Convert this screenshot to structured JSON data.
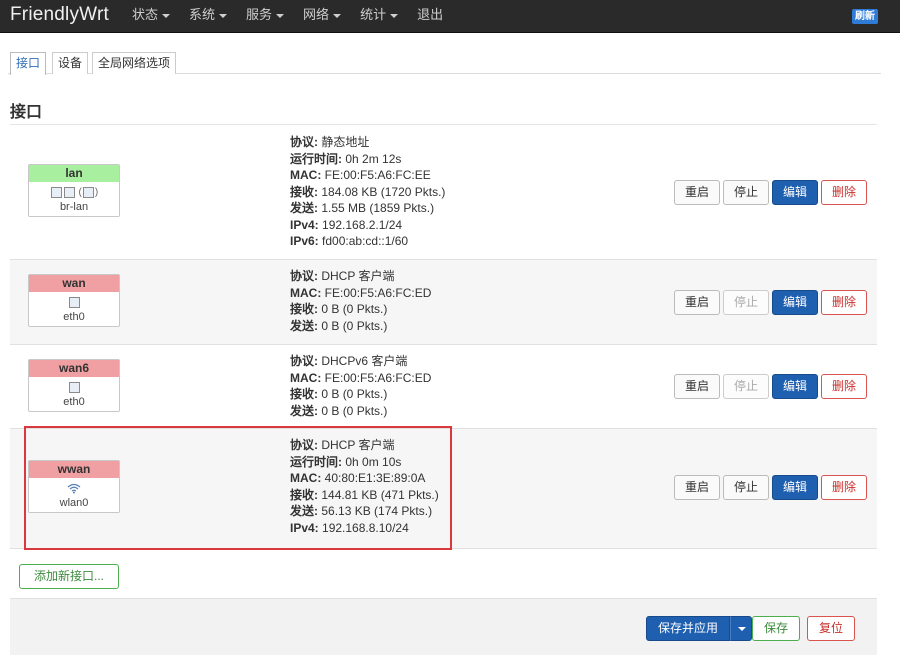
{
  "nav": {
    "brand": "FriendlyWrt",
    "menu": [
      "状态",
      "系统",
      "服务",
      "网络",
      "统计",
      "退出"
    ],
    "refresh": "刷新"
  },
  "tabs": [
    "接口",
    "设备",
    "全局网络选项"
  ],
  "section_title": "接口",
  "labels": {
    "proto": "协议:",
    "uptime": "运行时间:",
    "mac": "MAC:",
    "rx": "接收:",
    "tx": "发送:",
    "ipv4": "IPv4:",
    "ipv6": "IPv6:"
  },
  "buttons": {
    "restart": "重启",
    "stop": "停止",
    "edit": "编辑",
    "delete": "删除"
  },
  "interfaces": [
    {
      "name": "lan",
      "device": "br-lan",
      "icons": "(",
      "proto": "静态地址",
      "uptime": "0h 2m 12s",
      "mac": "FE:00:F5:A6:FC:EE",
      "rx": "184.08 KB (1720 Pkts.)",
      "tx": "1.55 MB (1859 Pkts.)",
      "ipv4": "192.168.2.1/24",
      "ipv6": "fd00:ab:cd::1/60"
    },
    {
      "name": "wan",
      "device": "eth0",
      "proto": "DHCP 客户端",
      "mac": "FE:00:F5:A6:FC:ED",
      "rx": "0 B (0 Pkts.)",
      "tx": "0 B (0 Pkts.)"
    },
    {
      "name": "wan6",
      "device": "eth0",
      "proto": "DHCPv6 客户端",
      "mac": "FE:00:F5:A6:FC:ED",
      "rx": "0 B (0 Pkts.)",
      "tx": "0 B (0 Pkts.)"
    },
    {
      "name": "wwan",
      "device": "wlan0",
      "proto": "DHCP 客户端",
      "uptime": "0h 0m 10s",
      "mac": "40:80:E1:3E:89:0A",
      "rx": "144.81 KB (471 Pkts.)",
      "tx": "56.13 KB (174 Pkts.)",
      "ipv4": "192.168.8.10/24"
    }
  ],
  "add_interface": "添加新接口...",
  "footer": {
    "save_apply": "保存并应用",
    "save": "保存",
    "reset": "复位"
  },
  "colors": {
    "highlight": "#d9393e",
    "lan_badge": "#a8f0a0",
    "wan_badge": "#f0a0a2",
    "primary": "#1f5fb0"
  }
}
